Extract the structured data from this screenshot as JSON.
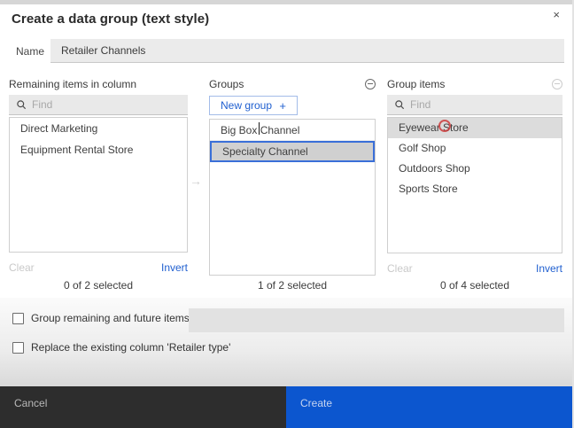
{
  "dialog": {
    "title": "Create a data group (text style)",
    "close_label": "×"
  },
  "name_field": {
    "label": "Name",
    "value": "Retailer Channels"
  },
  "remaining_panel": {
    "header": "Remaining items in column",
    "search_placeholder": "Find",
    "items": [
      "Direct Marketing",
      "Equipment Rental Store"
    ],
    "clear_label": "Clear",
    "invert_label": "Invert",
    "count": "0 of 2 selected"
  },
  "groups_panel": {
    "header": "Groups",
    "new_group_label": "New group",
    "new_group_plus": "+",
    "items": [
      "Big Box Channel",
      "Specialty Channel"
    ],
    "selected_item": "Specialty Channel",
    "count": "1 of 2 selected"
  },
  "group_items_panel": {
    "header": "Group items",
    "search_placeholder": "Find",
    "items": [
      "Eyewear Store",
      "Golf Shop",
      "Outdoors Shop",
      "Sports Store"
    ],
    "highlighted_item": "Eyewear Store",
    "clear_label": "Clear",
    "invert_label": "Invert",
    "count": "0 of 4 selected"
  },
  "transfer_arrow": "→",
  "options": {
    "group_remaining_label": "Group remaining and future items in",
    "group_remaining_value": "",
    "replace_column_label": "Replace the existing column 'Retailer type'"
  },
  "footer": {
    "cancel_label": "Cancel",
    "create_label": "Create"
  },
  "colors": {
    "accent_blue": "#2160d0",
    "create_blue": "#0c56cf",
    "cancel_dark": "#2d2d2d",
    "selection_border": "#3a6fd8",
    "selected_row_bg": "#d0d0d0",
    "highlight_row_bg": "#dcdcdc",
    "annotation_red": "#cd3c3c"
  }
}
